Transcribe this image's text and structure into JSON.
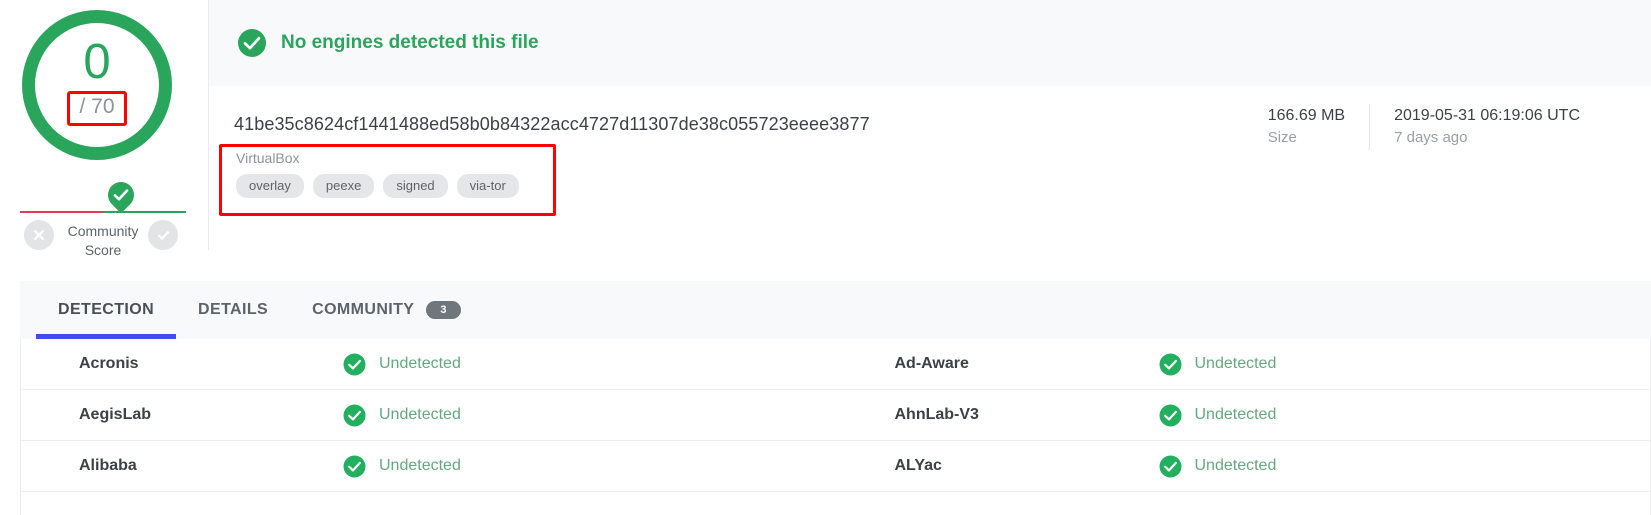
{
  "score": {
    "detections": "0",
    "total": "/ 70",
    "ring_color": "#2aa55c",
    "highlight_box_color": "#ff0000"
  },
  "community": {
    "label_line1": "Community",
    "label_line2": "Score",
    "negative_icon": "x-circle-icon",
    "positive_icon": "check-circle-icon",
    "marker_icon": "check-pin-icon",
    "negative_color": "#e8365d",
    "positive_color": "#2aa55c"
  },
  "verdict": {
    "icon": "check-circle-icon",
    "text": "No engines detected this file",
    "color": "#2aa55c"
  },
  "file": {
    "hash": "41be35c8624cf1441488ed58b0b84322acc4727d11307de38c055723eeee3877",
    "tags_heading": "VirtualBox",
    "tags": [
      "overlay",
      "peexe",
      "signed",
      "via-tor"
    ],
    "meta": [
      {
        "value": "166.69 MB",
        "label": "Size"
      },
      {
        "value": "2019-05-31 06:19:06 UTC",
        "label": "7 days ago"
      }
    ]
  },
  "tabs": [
    {
      "label": "DETECTION",
      "active": true,
      "badge": null
    },
    {
      "label": "DETAILS",
      "active": false,
      "badge": null
    },
    {
      "label": "COMMUNITY",
      "active": false,
      "badge": "3"
    }
  ],
  "engines": {
    "status_icon": "check-circle-icon",
    "rows": [
      {
        "left": {
          "name": "Acronis",
          "result": "Undetected"
        },
        "right": {
          "name": "Ad-Aware",
          "result": "Undetected"
        }
      },
      {
        "left": {
          "name": "AegisLab",
          "result": "Undetected"
        },
        "right": {
          "name": "AhnLab-V3",
          "result": "Undetected"
        }
      },
      {
        "left": {
          "name": "Alibaba",
          "result": "Undetected"
        },
        "right": {
          "name": "ALYac",
          "result": "Undetected"
        }
      }
    ]
  }
}
